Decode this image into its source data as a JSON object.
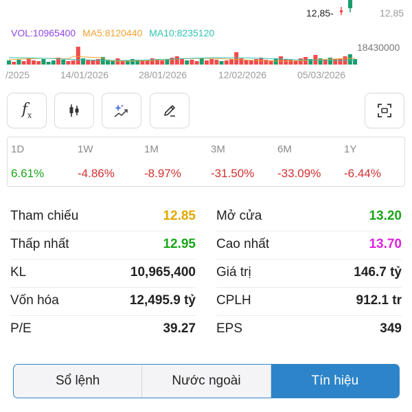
{
  "chart": {
    "last_price_tag": "12,85-",
    "price_axis_label": "12,85",
    "volume_legend": {
      "vol": "VOL:10965400",
      "ma5": "MA5:8120440",
      "ma10": "MA10:8235120",
      "vol_color": "#8e44e8",
      "ma5_color": "#f0a030",
      "ma10_color": "#2fc2b0"
    },
    "volume_axis_max": "18430000",
    "dates": [
      "/2025",
      "14/01/2026",
      "28/01/2026",
      "12/02/2026",
      "05/03/2026"
    ],
    "up_color": "#1a9c6c",
    "down_color": "#f04b4b"
  },
  "toolbar": {
    "icons": [
      "function-icon",
      "candlestick-icon",
      "ai-sparkle-icon",
      "pencil-icon",
      "fullscreen-icon"
    ],
    "function_glyph": "f",
    "function_sub": "x"
  },
  "periods": [
    {
      "label": "1D",
      "value": "6.61%",
      "color": "#1aa51a"
    },
    {
      "label": "1W",
      "value": "-4.86%",
      "color": "#d32f2f"
    },
    {
      "label": "1M",
      "value": "-8.97%",
      "color": "#d32f2f"
    },
    {
      "label": "3M",
      "value": "-31.50%",
      "color": "#d32f2f"
    },
    {
      "label": "6M",
      "value": "-33.09%",
      "color": "#d32f2f"
    },
    {
      "label": "1Y",
      "value": "-6.44%",
      "color": "#d32f2f"
    }
  ],
  "stats": {
    "tham_chieu": {
      "label": "Tham chiếu",
      "value": "12.85",
      "color": "#e0a800"
    },
    "mo_cua": {
      "label": "Mở cửa",
      "value": "13.20",
      "color": "#1aa51a"
    },
    "thap_nhat": {
      "label": "Thấp nhất",
      "value": "12.95",
      "color": "#1aa51a"
    },
    "cao_nhat": {
      "label": "Cao nhất",
      "value": "13.70",
      "color": "#e020e0"
    },
    "kl": {
      "label": "KL",
      "value": "10,965,400"
    },
    "gia_tri": {
      "label": "Giá trị",
      "value": "146.7 tỷ"
    },
    "von_hoa": {
      "label": "Vốn hóa",
      "value": "12,495.9 tỷ"
    },
    "cplh": {
      "label": "CPLH",
      "value": "912.1 tr"
    },
    "pe": {
      "label": "P/E",
      "value": "39.27"
    },
    "eps": {
      "label": "EPS",
      "value": "349"
    }
  },
  "tabs": {
    "items": [
      "Sổ lệnh",
      "Nước ngoài",
      "Tín hiệu"
    ],
    "active_index": 2,
    "active_color": "#2d84c8"
  }
}
